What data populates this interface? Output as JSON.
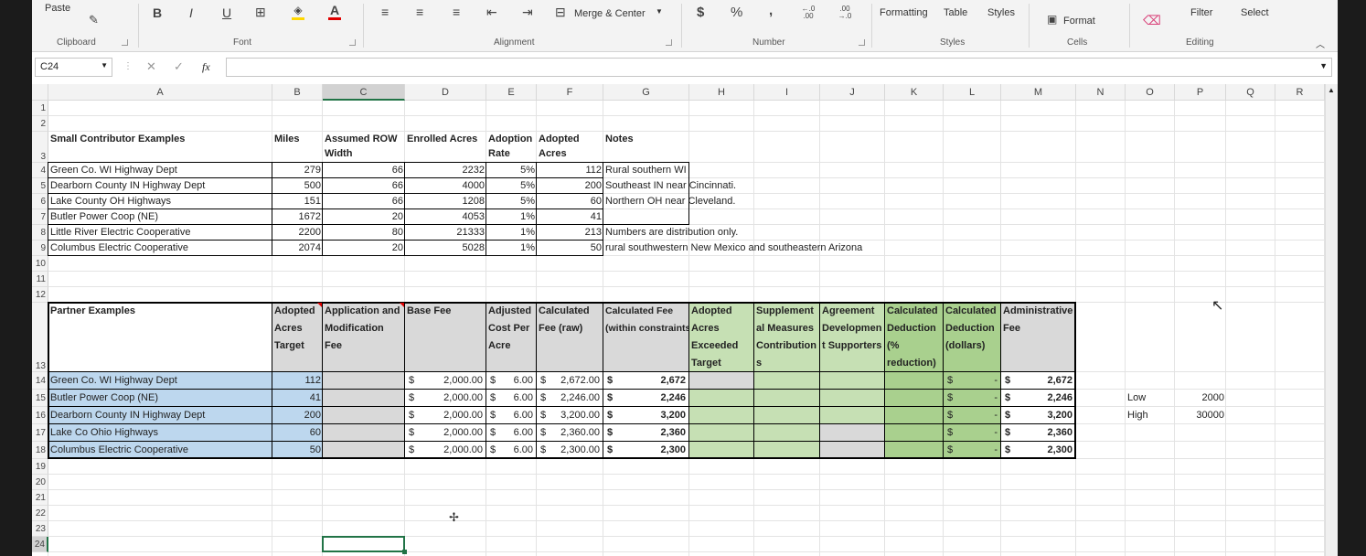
{
  "ribbon": {
    "paste": "Paste",
    "groups": [
      "Clipboard",
      "Font",
      "Alignment",
      "Number",
      "Styles",
      "Cells",
      "Editing"
    ],
    "merge_center": "Merge & Center",
    "number_currency": "$",
    "number_percent": "%",
    "number_comma": ",",
    "inc_decimal": "←.0 .00",
    "dec_decimal": ".00 →.0",
    "cond_formatting": "Formatting",
    "format_as_table": "Table",
    "cell_styles": "Styles",
    "format": "Format",
    "sort_filter": "Filter",
    "find_select": "Select",
    "bold": "B",
    "italic": "I",
    "underline": "U"
  },
  "formula_bar": {
    "name_box": "C24",
    "fx": "fx",
    "value": ""
  },
  "columns": [
    "A",
    "B",
    "C",
    "D",
    "E",
    "F",
    "G",
    "H",
    "I",
    "J",
    "K",
    "L",
    "M",
    "N",
    "O",
    "P",
    "Q",
    "R"
  ],
  "rows": [
    "1",
    "2",
    "3",
    "4",
    "5",
    "6",
    "7",
    "8",
    "9",
    "10",
    "11",
    "12",
    "13",
    "14",
    "15",
    "16",
    "17",
    "18",
    "19",
    "20",
    "21",
    "22",
    "23",
    "24"
  ],
  "small": {
    "headers": {
      "a": "Small Contributor Examples",
      "b": "Miles",
      "c1": "Assumed ROW",
      "c2": "Width",
      "d": "Enrolled Acres",
      "e1": "Adoption",
      "e2": "Rate",
      "f1": "Adopted",
      "f2": "Acres",
      "g": "Notes"
    },
    "rows": [
      {
        "name": "Green Co. WI Highway Dept",
        "miles": "279",
        "row": "66",
        "acres": "2232",
        "rate": "5%",
        "adopted": "112",
        "notes": "Rural southern WI"
      },
      {
        "name": "Dearborn County IN Highway Dept",
        "miles": "500",
        "row": "66",
        "acres": "4000",
        "rate": "5%",
        "adopted": "200",
        "notes": "Southeast IN near Cincinnati."
      },
      {
        "name": "Lake County OH Highways",
        "miles": "151",
        "row": "66",
        "acres": "1208",
        "rate": "5%",
        "adopted": "60",
        "notes": "Northern OH near Cleveland."
      },
      {
        "name": "Butler Power Coop (NE)",
        "miles": "1672",
        "row": "20",
        "acres": "4053",
        "rate": "1%",
        "adopted": "41",
        "notes": ""
      },
      {
        "name": "Little River Electric Cooperative",
        "miles": "2200",
        "row": "80",
        "acres": "21333",
        "rate": "1%",
        "adopted": "213",
        "notes": "Numbers are distribution only."
      },
      {
        "name": "Columbus Electric Cooperative",
        "miles": "2074",
        "row": "20",
        "acres": "5028",
        "rate": "1%",
        "adopted": "50",
        "notes": "rural southwestern New Mexico and southeastern Arizona"
      }
    ]
  },
  "partner": {
    "headers": {
      "a": "Partner Examples",
      "b": [
        "Adopted",
        "Acres",
        "Target"
      ],
      "c": [
        "Application and",
        "Modification",
        "Fee"
      ],
      "d": [
        "Base Fee"
      ],
      "e": [
        "Adjusted",
        "Cost Per",
        "Acre"
      ],
      "f": [
        "Calculated",
        "Fee (raw)"
      ],
      "g": [
        "Calculated Fee",
        "(within constraints)"
      ],
      "h": [
        "Adopted",
        "Acres",
        "Exceeded",
        "Target"
      ],
      "i": [
        "Supplement",
        "al Measures",
        "Contribution",
        "s"
      ],
      "j": [
        "Agreement",
        "Developmen",
        "t Supporters"
      ],
      "k": [
        "Calculated",
        "Deduction",
        "(%",
        "reduction)"
      ],
      "l": [
        "Calculated",
        "Deduction",
        "(dollars)"
      ],
      "m": [
        "Administrative",
        "Fee"
      ]
    },
    "currency": "$",
    "dash": "-",
    "rows": [
      {
        "name": "Green Co. WI Highway Dept",
        "target": "112",
        "base": "2,000.00",
        "cpa": "6.00",
        "raw": "2,672.00",
        "fee": "2,672",
        "admin": "2,672"
      },
      {
        "name": "Butler Power Coop (NE)",
        "target": "41",
        "base": "2,000.00",
        "cpa": "6.00",
        "raw": "2,246.00",
        "fee": "2,246",
        "admin": "2,246"
      },
      {
        "name": "Dearborn County IN Highway Dept",
        "target": "200",
        "base": "2,000.00",
        "cpa": "6.00",
        "raw": "3,200.00",
        "fee": "3,200",
        "admin": "3,200"
      },
      {
        "name": "Lake Co Ohio Highways",
        "target": "60",
        "base": "2,000.00",
        "cpa": "6.00",
        "raw": "2,360.00",
        "fee": "2,360",
        "admin": "2,360"
      },
      {
        "name": "Columbus Electric Cooperative",
        "target": "50",
        "base": "2,000.00",
        "cpa": "6.00",
        "raw": "2,300.00",
        "fee": "2,300",
        "admin": "2,300"
      }
    ]
  },
  "constraints": {
    "low_label": "Low",
    "low_value": "2000",
    "high_label": "High",
    "high_value": "30000"
  },
  "colors": {
    "blue": "#bdd7ee",
    "gray": "#d9d9d9",
    "green_light": "#c6e0b4",
    "green_dark": "#a9d08e"
  }
}
